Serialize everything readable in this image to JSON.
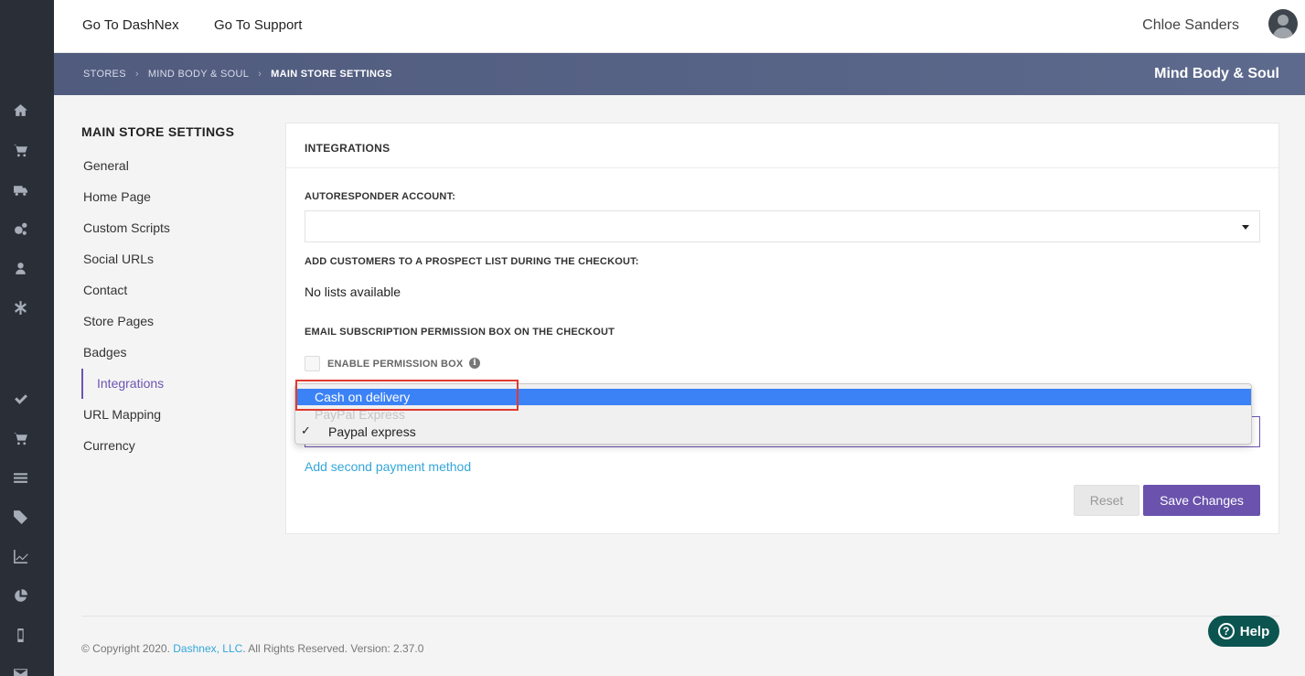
{
  "topbar": {
    "links": [
      "Go To DashNex",
      "Go To Support"
    ],
    "user_name": "Chloe Sanders"
  },
  "breadcrumb": {
    "items": [
      "STORES",
      "MIND BODY & SOUL",
      "MAIN STORE SETTINGS"
    ],
    "store_name": "Mind Body & Soul"
  },
  "sidebar_icons": [
    "home-icon",
    "cart-icon",
    "truck-icon",
    "gears-icon",
    "user-icon",
    "asterisk-icon",
    "check-icon",
    "cart-icon",
    "list-icon",
    "tags-icon",
    "line-chart-icon",
    "pie-chart-icon",
    "mobile-icon",
    "envelope-icon"
  ],
  "settings_nav": {
    "title": "MAIN STORE SETTINGS",
    "items": [
      "General",
      "Home Page",
      "Custom Scripts",
      "Social URLs",
      "Contact",
      "Store Pages",
      "Badges",
      "Integrations",
      "URL Mapping",
      "Currency"
    ],
    "active": "Integrations"
  },
  "panel": {
    "title": "INTEGRATIONS",
    "autoresponder_label": "AUTORESPONDER ACCOUNT:",
    "autoresponder_value": "",
    "prospect_label": "ADD CUSTOMERS TO A PROSPECT LIST DURING THE CHECKOUT:",
    "prospect_value": "No lists available",
    "email_perm_label": "EMAIL SUBSCRIPTION PERMISSION BOX ON THE CHECKOUT",
    "enable_perm_label": "ENABLE PERMISSION BOX",
    "enable_perm_checked": false,
    "add_second_payment": "Add second payment method",
    "reset_label": "Reset",
    "save_label": "Save Changes"
  },
  "payment_dropdown": {
    "options": [
      {
        "label": "Cash on delivery",
        "state": "highlighted"
      },
      {
        "label": "PayPal Express",
        "state": "disabled"
      },
      {
        "label": "Paypal express",
        "state": "checked"
      }
    ],
    "check_mark": "✓"
  },
  "footer": {
    "prefix": "© Copyright 2020.",
    "company": "Dashnex, LLC",
    "suffix": ". All Rights Reserved. Version: 2.37.0"
  },
  "help_button": {
    "label": "Help",
    "icon": "?"
  },
  "colors": {
    "accent": "#6a52ad",
    "link": "#33a6d9",
    "highlight": "#3b82f6",
    "help": "#0b5450",
    "rail": "#2a2f37"
  }
}
